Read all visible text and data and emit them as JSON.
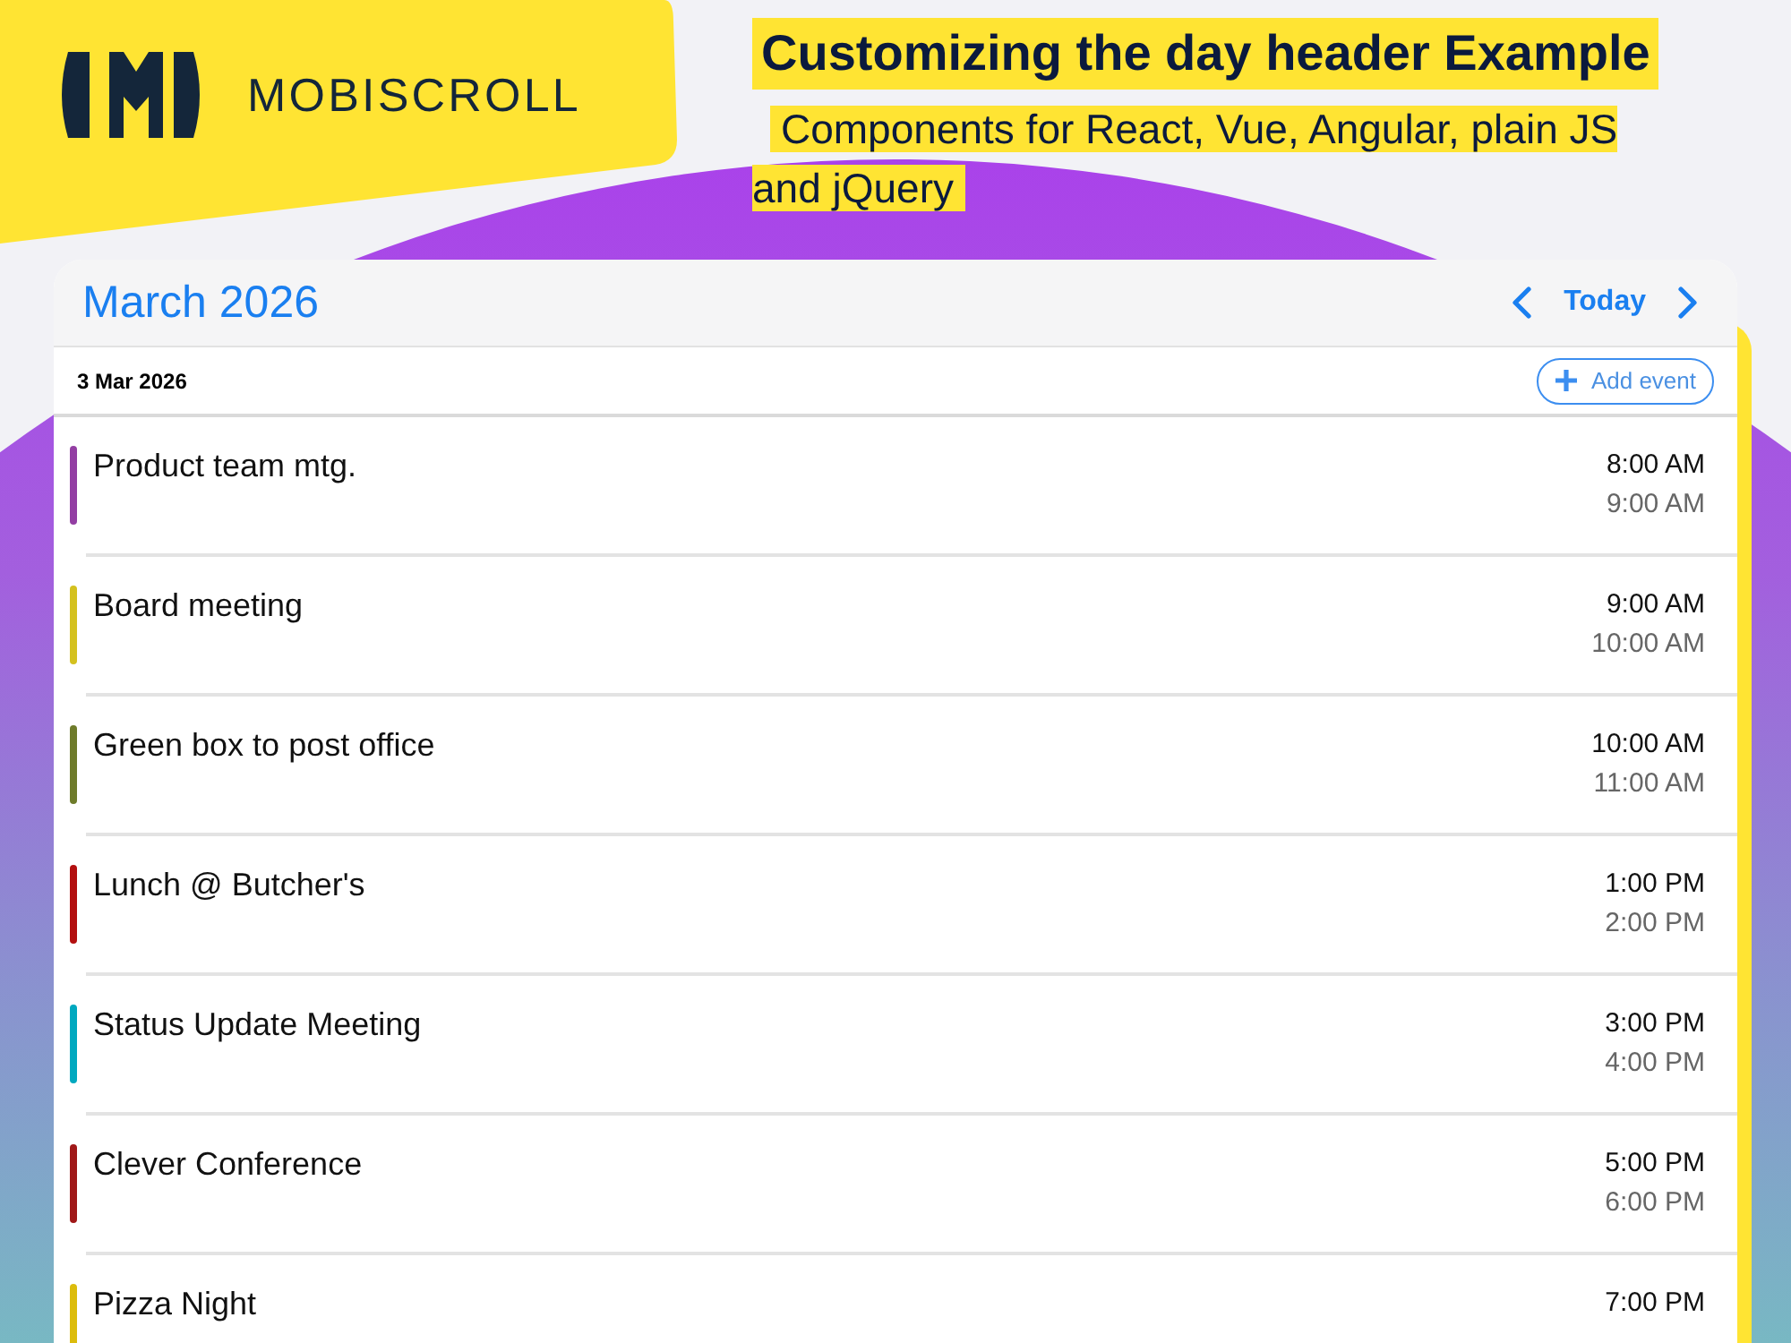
{
  "brand": {
    "name": "MOBISCROLL"
  },
  "heading": {
    "title": "Customizing the day header Example",
    "subtitle": "Components for React, Vue, Angular, plain JS and jQuery"
  },
  "calendar": {
    "month_title": "March 2026",
    "today_button": "Today",
    "day_header": {
      "date": "3 Mar 2026",
      "add_button": "Add event"
    },
    "events": [
      {
        "title": "Product team mtg.",
        "start": "8:00 AM",
        "end": "9:00 AM",
        "color": "#933ea3"
      },
      {
        "title": "Board meeting",
        "start": "9:00 AM",
        "end": "10:00 AM",
        "color": "#d4c11f"
      },
      {
        "title": "Green box to post office",
        "start": "10:00 AM",
        "end": "11:00 AM",
        "color": "#6e7b2a"
      },
      {
        "title": "Lunch @ Butcher's",
        "start": "1:00 PM",
        "end": "2:00 PM",
        "color": "#b30f0f"
      },
      {
        "title": "Status Update Meeting",
        "start": "3:00 PM",
        "end": "4:00 PM",
        "color": "#00a8bf"
      },
      {
        "title": "Clever Conference",
        "start": "5:00 PM",
        "end": "6:00 PM",
        "color": "#a01818"
      },
      {
        "title": "Pizza Night",
        "start": "7:00 PM",
        "color": "#dcbc0c"
      }
    ]
  }
}
